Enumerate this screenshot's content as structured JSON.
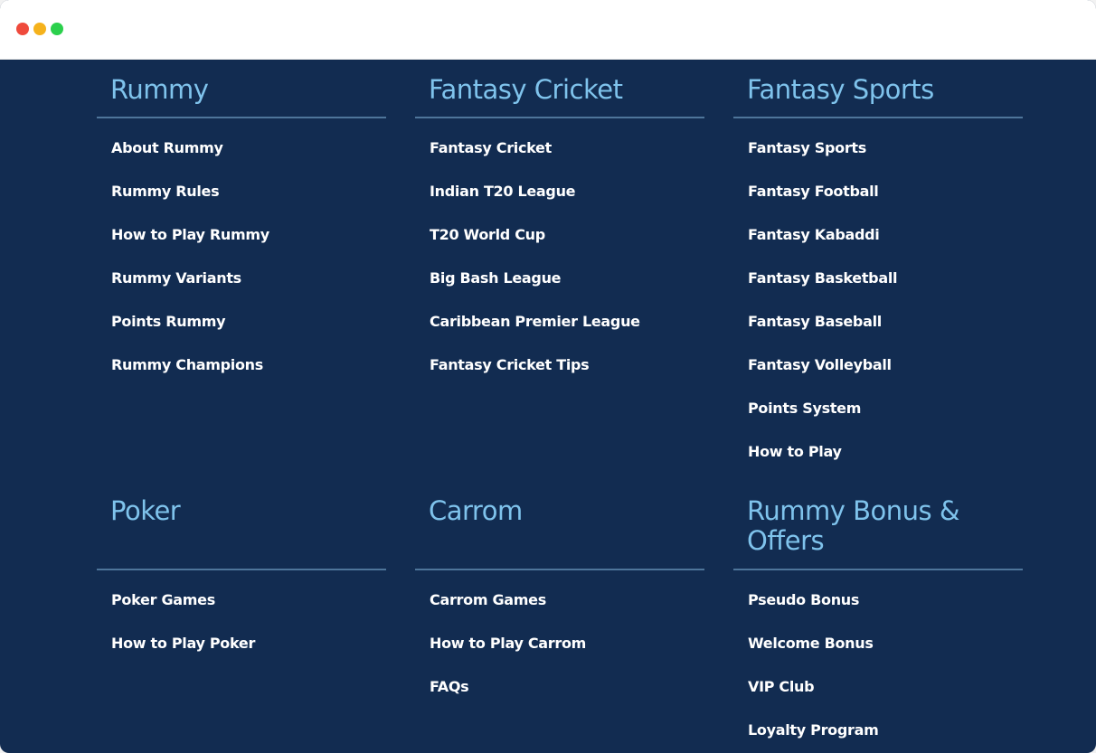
{
  "sections": [
    {
      "title": "Rummy",
      "links": [
        "About Rummy",
        "Rummy Rules",
        "How to Play Rummy",
        "Rummy Variants",
        "Points Rummy",
        "Rummy Champions"
      ]
    },
    {
      "title": "Fantasy Cricket",
      "links": [
        "Fantasy Cricket",
        "Indian T20 League",
        "T20 World Cup",
        "Big Bash League",
        "Caribbean Premier League",
        "Fantasy Cricket Tips"
      ]
    },
    {
      "title": "Fantasy Sports",
      "links": [
        "Fantasy Sports",
        "Fantasy Football",
        "Fantasy Kabaddi",
        "Fantasy Basketball",
        "Fantasy Baseball",
        "Fantasy Volleyball",
        "Points System",
        "How to Play"
      ]
    },
    {
      "title": "Poker",
      "links": [
        "Poker Games",
        "How to Play Poker"
      ]
    },
    {
      "title": "Carrom",
      "links": [
        "Carrom Games",
        "How to Play Carrom",
        "FAQs"
      ]
    },
    {
      "title": "Rummy Bonus & Offers",
      "links": [
        "Pseudo Bonus",
        "Welcome Bonus",
        "VIP Club",
        "Loyalty Program"
      ]
    }
  ],
  "colors": {
    "background": "#122c51",
    "heading": "#7fc3ec",
    "link": "#ffffff",
    "divider": "#4e759a"
  }
}
